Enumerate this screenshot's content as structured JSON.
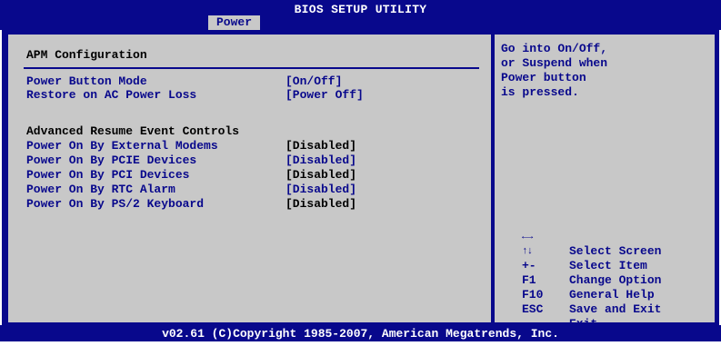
{
  "window": {
    "title": "BIOS SETUP UTILITY",
    "active_tab": "Power"
  },
  "main": {
    "header": "APM Configuration",
    "settings": [
      {
        "label": "Power Button Mode",
        "value": "[On/Off]"
      },
      {
        "label": "Restore on AC Power Loss",
        "value": "[Power Off]"
      }
    ],
    "section": "Advanced Resume Event Controls",
    "resume_settings": [
      {
        "label": "Power On By External Modems",
        "value": "[Disabled]"
      },
      {
        "label": "Power On By PCIE Devices",
        "value": "[Disabled]"
      },
      {
        "label": "Power On By PCI Devices",
        "value": "[Disabled]"
      },
      {
        "label": "Power On By RTC Alarm",
        "value": "[Disabled]"
      },
      {
        "label": "Power On By PS/2 Keyboard",
        "value": "[Disabled]"
      }
    ]
  },
  "help": {
    "lines": [
      "Go into On/Off,",
      "or Suspend when",
      "Power button",
      "is pressed."
    ]
  },
  "keys": [
    {
      "key": "←→",
      "desc": "Select Screen",
      "icon": "left-right-arrows-icon"
    },
    {
      "key": "↑↓",
      "desc": "Select Item",
      "icon": "up-down-arrows-icon"
    },
    {
      "key": "+-",
      "desc": "Change Option"
    },
    {
      "key": "F1",
      "desc": "General Help"
    },
    {
      "key": "F10",
      "desc": "Save and Exit"
    },
    {
      "key": "ESC",
      "desc": "Exit"
    }
  ],
  "footer": {
    "copyright": "v02.61 (C)Copyright 1985-2007, American Megatrends, Inc."
  },
  "colors": {
    "frame_blue": "#08088c",
    "panel_gray": "#c8c8c8",
    "text_white": "#ffffff"
  }
}
